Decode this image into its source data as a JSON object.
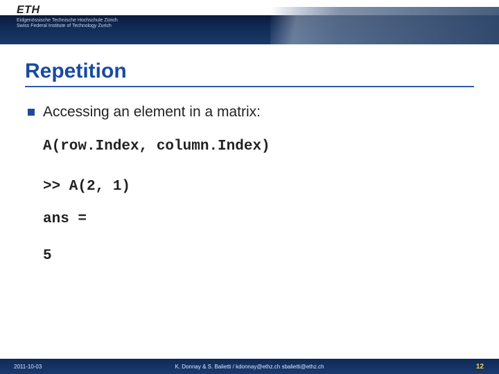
{
  "header": {
    "logo_text": "ETH",
    "subtext_line1": "Eidgenössische Technische Hochschule Zürich",
    "subtext_line2": "Swiss Federal Institute of Technology Zurich"
  },
  "slide": {
    "title": "Repetition",
    "bullet_text": "Accessing an element in a matrix:",
    "code_line1": "A(row.Index, column.Index)",
    "code_line2": ">> A(2, 1)",
    "code_line3": "ans =",
    "code_line4": "5"
  },
  "footer": {
    "date": "2011-10-03",
    "credit": "K. Donnay & S. Balietti / kdonnay@ethz.ch  sbalietti@ethz.ch",
    "page": "12"
  }
}
